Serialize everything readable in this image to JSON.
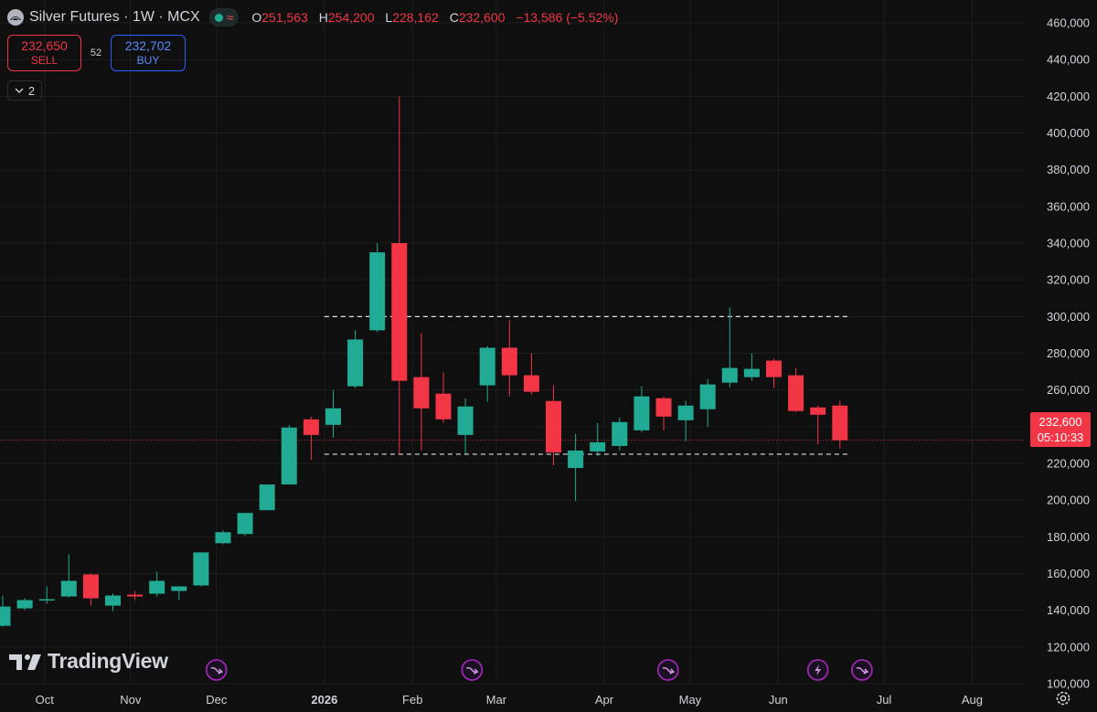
{
  "legend": {
    "title": "Silver Futures · 1W · MCX",
    "o_label": "O",
    "o_value": "251,563",
    "h_label": "H",
    "h_value": "254,200",
    "l_label": "L",
    "l_value": "228,162",
    "c_label": "C",
    "c_value": "232,600",
    "change": "−13,586 (−5.52%)"
  },
  "trade": {
    "sell_price": "232,650",
    "sell_label": "SELL",
    "spread": "52",
    "buy_price": "232,702",
    "buy_label": "BUY"
  },
  "indicators_count": "2",
  "logo_text": "TradingView",
  "last_price": {
    "value": "232,600",
    "countdown": "05:10:33"
  },
  "colors": {
    "up": "#22ab94",
    "down": "#f23645",
    "background": "#0f0f0f",
    "grid": "#1e1e1e",
    "axis_text": "#d1d4dc",
    "event_icon": "#9c27b0"
  },
  "chart_data": {
    "type": "candlestick",
    "title": "Silver Futures · 1W · MCX",
    "ylim": [
      94000,
      466000
    ],
    "y_ticks": [
      100000,
      120000,
      140000,
      160000,
      180000,
      200000,
      220000,
      240000,
      260000,
      280000,
      300000,
      320000,
      340000,
      360000,
      380000,
      400000,
      420000,
      440000,
      460000
    ],
    "y_tick_labels": [
      "100,000",
      "120,000",
      "140,000",
      "160,000",
      "180,000",
      "200,000",
      "220,000",
      "240,000",
      "260,000",
      "280,000",
      "300,000",
      "320,000",
      "340,000",
      "360,000",
      "380,000",
      "400,000",
      "420,000",
      "440,000",
      "460,000"
    ],
    "x_labels": [
      {
        "label": "Oct",
        "at": 1.9
      },
      {
        "label": "Nov",
        "at": 5.8
      },
      {
        "label": "Dec",
        "at": 9.7
      },
      {
        "label": "2026",
        "at": 14.6,
        "bold": true
      },
      {
        "label": "Feb",
        "at": 18.6
      },
      {
        "label": "Mar",
        "at": 22.4
      },
      {
        "label": "Apr",
        "at": 27.3
      },
      {
        "label": "May",
        "at": 31.2
      },
      {
        "label": "Jun",
        "at": 35.2
      },
      {
        "label": "Jul",
        "at": 40.0
      },
      {
        "label": "Aug",
        "at": 44.0
      }
    ],
    "candles": [
      {
        "o": 131500,
        "h": 148000,
        "l": 131000,
        "c": 142000
      },
      {
        "o": 141000,
        "h": 146500,
        "l": 140000,
        "c": 145500
      },
      {
        "o": 145500,
        "h": 153000,
        "l": 143500,
        "c": 146000
      },
      {
        "o": 147500,
        "h": 170500,
        "l": 147000,
        "c": 156000
      },
      {
        "o": 159500,
        "h": 160000,
        "l": 142500,
        "c": 146500
      },
      {
        "o": 142500,
        "h": 149000,
        "l": 139500,
        "c": 148000
      },
      {
        "o": 148500,
        "h": 150500,
        "l": 145500,
        "c": 147500
      },
      {
        "o": 149000,
        "h": 161000,
        "l": 147500,
        "c": 156000
      },
      {
        "o": 150500,
        "h": 153000,
        "l": 145500,
        "c": 153000
      },
      {
        "o": 153500,
        "h": 171500,
        "l": 153000,
        "c": 171500
      },
      {
        "o": 176500,
        "h": 183500,
        "l": 176000,
        "c": 182500
      },
      {
        "o": 181500,
        "h": 192500,
        "l": 180500,
        "c": 193000
      },
      {
        "o": 194500,
        "h": 208000,
        "l": 194500,
        "c": 208500
      },
      {
        "o": 208500,
        "h": 241000,
        "l": 208500,
        "c": 239500
      },
      {
        "o": 244000,
        "h": 245500,
        "l": 222000,
        "c": 235500
      },
      {
        "o": 241000,
        "h": 260000,
        "l": 234000,
        "c": 250000
      },
      {
        "o": 262000,
        "h": 292500,
        "l": 261000,
        "c": 287500
      },
      {
        "o": 292500,
        "h": 340000,
        "l": 291500,
        "c": 335000
      },
      {
        "o": 340000,
        "h": 420000,
        "l": 225000,
        "c": 265000
      },
      {
        "o": 267000,
        "h": 291000,
        "l": 227000,
        "c": 250000
      },
      {
        "o": 258000,
        "h": 269500,
        "l": 242000,
        "c": 244000
      },
      {
        "o": 235500,
        "h": 255500,
        "l": 225500,
        "c": 251000
      },
      {
        "o": 262500,
        "h": 284000,
        "l": 253500,
        "c": 283000
      },
      {
        "o": 283000,
        "h": 298000,
        "l": 256500,
        "c": 268000
      },
      {
        "o": 268000,
        "h": 280000,
        "l": 257500,
        "c": 259000
      },
      {
        "o": 254000,
        "h": 262500,
        "l": 219000,
        "c": 226000
      },
      {
        "o": 217500,
        "h": 236000,
        "l": 199500,
        "c": 227000
      },
      {
        "o": 226500,
        "h": 242000,
        "l": 224000,
        "c": 231500
      },
      {
        "o": 229500,
        "h": 245000,
        "l": 227000,
        "c": 242500
      },
      {
        "o": 238000,
        "h": 262000,
        "l": 237000,
        "c": 256500
      },
      {
        "o": 255500,
        "h": 256500,
        "l": 238000,
        "c": 245500
      },
      {
        "o": 243500,
        "h": 254000,
        "l": 232000,
        "c": 251500
      },
      {
        "o": 249500,
        "h": 266000,
        "l": 240000,
        "c": 263000
      },
      {
        "o": 264000,
        "h": 305000,
        "l": 261500,
        "c": 272000
      },
      {
        "o": 267000,
        "h": 280000,
        "l": 265000,
        "c": 271500
      },
      {
        "o": 276000,
        "h": 277000,
        "l": 261000,
        "c": 267000
      },
      {
        "o": 268000,
        "h": 272000,
        "l": 248000,
        "c": 248500
      },
      {
        "o": 250500,
        "h": 251500,
        "l": 230500,
        "c": 246500
      },
      {
        "o": 251500,
        "h": 254200,
        "l": 228162,
        "c": 232600
      }
    ],
    "hlines": [
      {
        "y": 300000,
        "from": 14.6,
        "to": 38.5
      },
      {
        "y": 225000,
        "from": 14.6,
        "to": 38.5
      }
    ],
    "last_price_line": 232600,
    "events": [
      {
        "at": 9.7,
        "kind": "dividend"
      },
      {
        "at": 21.3,
        "kind": "dividend"
      },
      {
        "at": 30.2,
        "kind": "dividend"
      },
      {
        "at": 37.0,
        "kind": "earnings"
      },
      {
        "at": 39.0,
        "kind": "dividend"
      }
    ]
  }
}
